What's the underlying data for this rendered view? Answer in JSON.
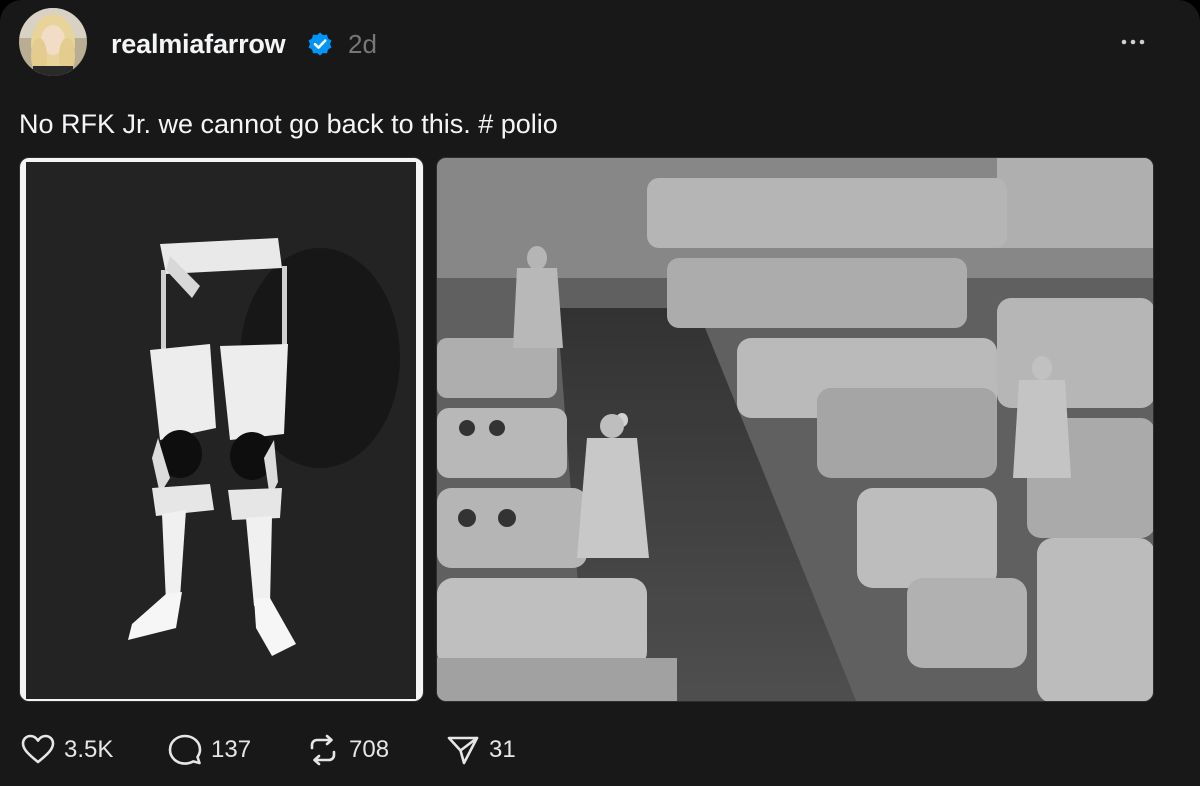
{
  "post": {
    "author": {
      "username": "realmiafarrow",
      "verified": true,
      "avatar_icon": "profile-photo-blonde-woman"
    },
    "timestamp": "2d",
    "more_icon": "more-dots-icon",
    "caption": "No RFK Jr. we cannot go back to this. # polio",
    "media": [
      {
        "kind": "photo",
        "subject": "leg-braces-photo"
      },
      {
        "kind": "photo",
        "subject": "iron-lung-ward-photo"
      }
    ],
    "actions": {
      "likes": "3.5K",
      "replies": "137",
      "reposts": "708",
      "shares": "31"
    }
  },
  "colors": {
    "background": "#181818",
    "text": "#f3f5f7",
    "muted": "#777777",
    "verified_blue": "#0095f6"
  }
}
